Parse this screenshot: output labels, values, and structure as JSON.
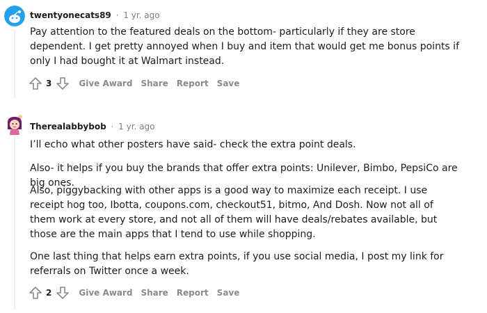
{
  "comments": [
    {
      "username": "twentyonecats89",
      "time": "1 yr. ago",
      "paragraphs": [
        "Pay attention to the featured deals on the bottom- particularly if they are store dependent. I get pretty annoyed when I buy and item that would get me bonus points if only I had bought it at Walmart instead."
      ],
      "score": "3",
      "actions": {
        "award": "Give Award",
        "share": "Share",
        "report": "Report",
        "save": "Save"
      },
      "avatar_icon": "snoo-avatar-icon"
    },
    {
      "username": "Therealabbybob",
      "time": "1 yr. ago",
      "paragraphs": [
        "I’ll echo what other posters have said- check the extra point deals.",
        "Also- it helps if you buy the brands that offer extra points: Unilever, Bimbo, PepsiCo are big ones.",
        "Also, piggybacking with other apps is a good way to maximize each receipt. I use receipt hog too, Ibotta, coupons.com, checkout51, bitmo, And Dosh. Now not all of them work at every store, and not all of them will have deals/rebates available, but those are the main apps that I tend to use while shopping.",
        "One last thing that helps earn extra points, if you use social media, I post my link for referrals on Twitter once a week."
      ],
      "score": "2",
      "actions": {
        "award": "Give Award",
        "share": "Share",
        "report": "Report",
        "save": "Save"
      },
      "avatar_icon": "character-avatar-icon"
    }
  ],
  "separator": "·",
  "colors": {
    "text": "#1c1c1c",
    "meta": "#878a8c",
    "thread_line": "#edeff1",
    "avatar1_bg": "#24a0ed"
  }
}
